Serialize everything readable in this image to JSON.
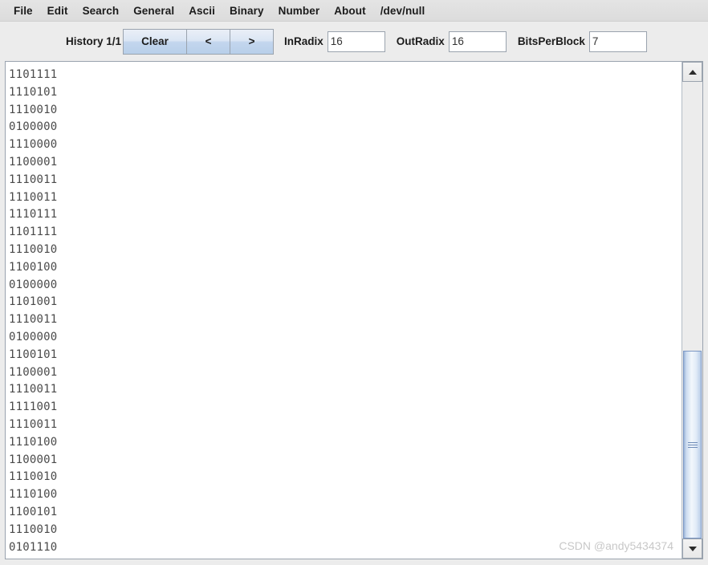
{
  "menubar": {
    "items": [
      {
        "label": "File",
        "name": "menu-file"
      },
      {
        "label": "Edit",
        "name": "menu-edit"
      },
      {
        "label": "Search",
        "name": "menu-search"
      },
      {
        "label": "General",
        "name": "menu-general"
      },
      {
        "label": "Ascii",
        "name": "menu-ascii"
      },
      {
        "label": "Binary",
        "name": "menu-binary"
      },
      {
        "label": "Number",
        "name": "menu-number"
      },
      {
        "label": "About",
        "name": "menu-about"
      },
      {
        "label": "/dev/null",
        "name": "menu-dev-null"
      }
    ]
  },
  "toolbar": {
    "history_label": "History 1/1",
    "clear_label": "Clear",
    "prev_label": "<",
    "next_label": ">",
    "inradix_label": "InRadix",
    "inradix_value": "16",
    "outradix_label": "OutRadix",
    "outradix_value": "16",
    "bitsperblock_label": "BitsPerBlock",
    "bitsperblock_value": "7"
  },
  "content": {
    "lines": [
      "1101111",
      "1110101",
      "1110010",
      "0100000",
      "1110000",
      "1100001",
      "1110011",
      "1110011",
      "1110111",
      "1101111",
      "1110010",
      "1100100",
      "0100000",
      "1101001",
      "1110011",
      "0100000",
      "1100101",
      "1100001",
      "1110011",
      "1111001",
      "1110011",
      "1110100",
      "1100001",
      "1110010",
      "1110100",
      "1100101",
      "1110010",
      "0101110"
    ],
    "watermark": "CSDN @andy5434374"
  },
  "scrollbar": {
    "up_arrow": "scroll-up-arrow",
    "down_arrow": "scroll-down-arrow"
  },
  "colors": {
    "window_bg": "#ececec",
    "menubar_bg": "#e0e0e0",
    "button_accent": "#b8cfe9",
    "text_color": "#4a4a4a",
    "border": "#9aa3ae",
    "scrollbar_thumb": "#cfe0f3"
  }
}
